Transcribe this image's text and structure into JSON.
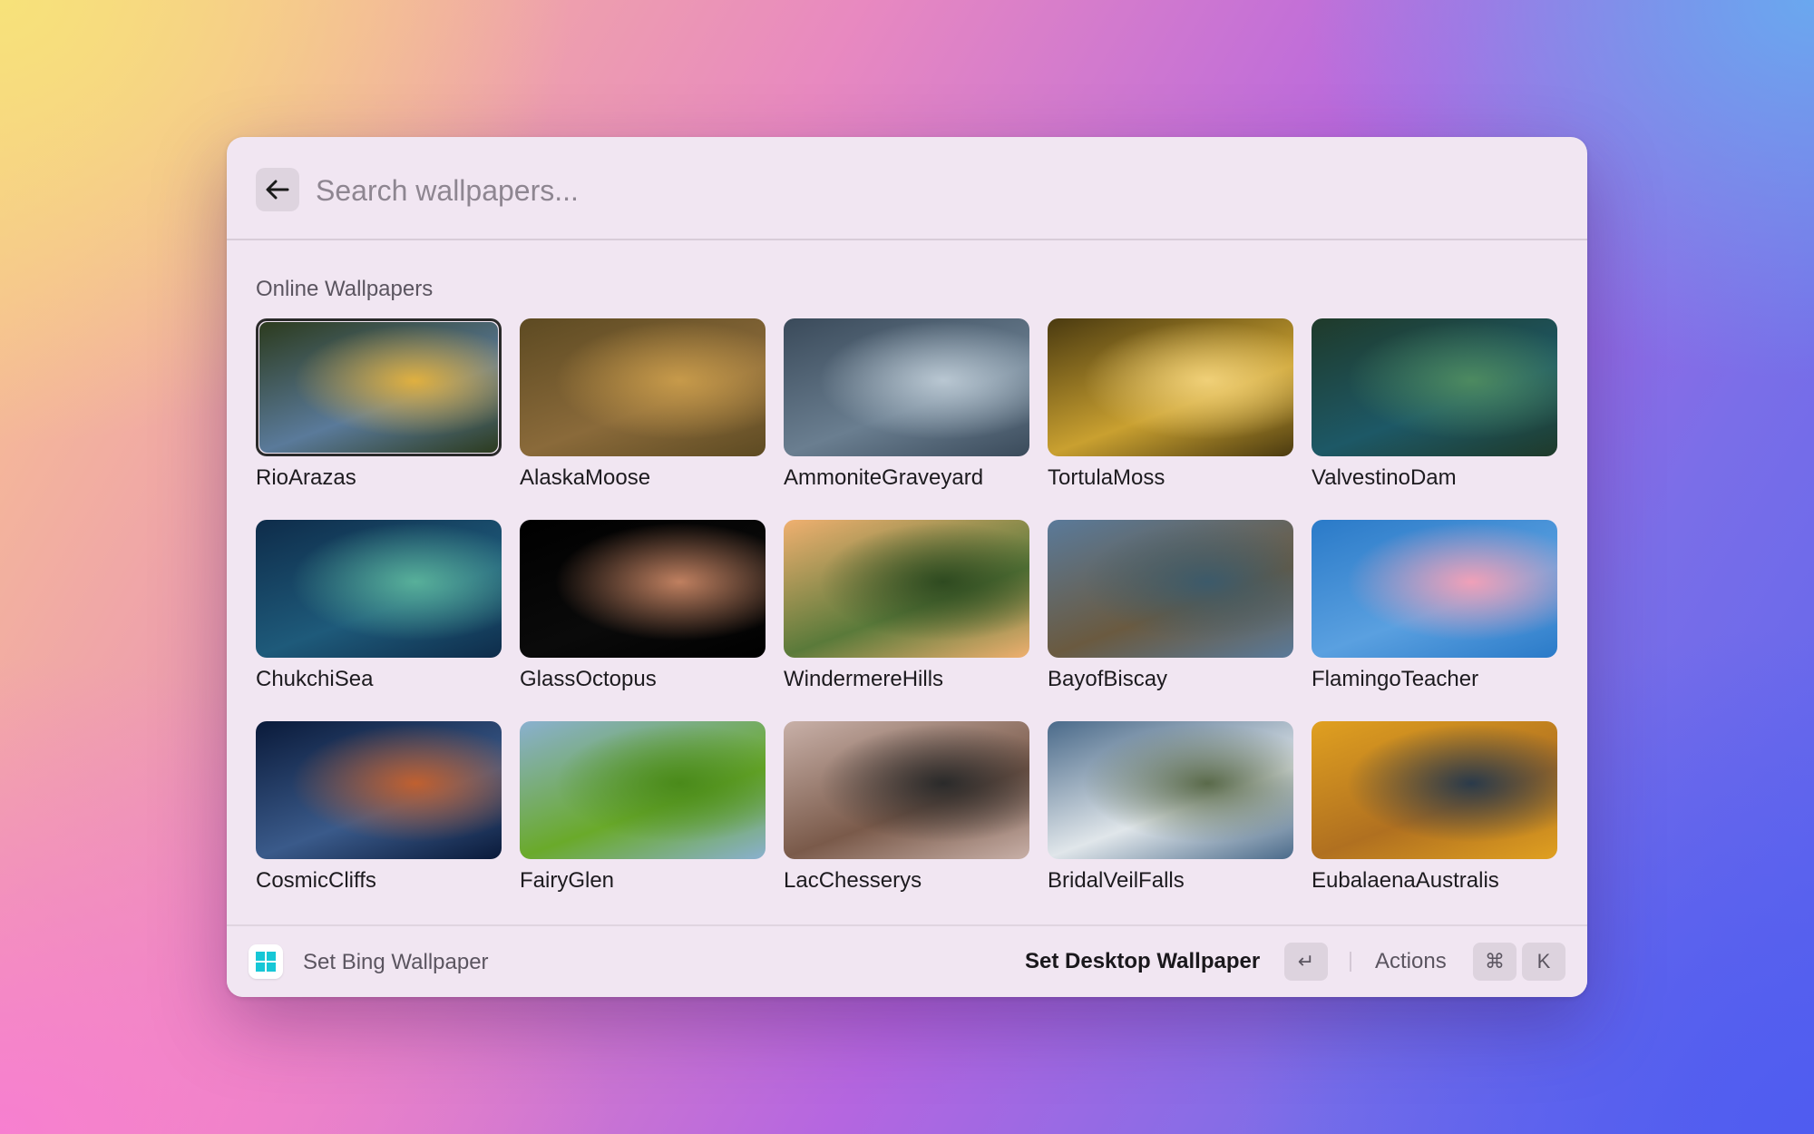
{
  "search": {
    "placeholder": "Search wallpapers..."
  },
  "section": {
    "title": "Online Wallpapers"
  },
  "wallpapers": [
    {
      "name": "RioArazas",
      "selected": true,
      "colors": [
        "#2c3b1e",
        "#5a7a9a",
        "#e0b040"
      ]
    },
    {
      "name": "AlaskaMoose",
      "colors": [
        "#5d4a22",
        "#8a6a3a",
        "#c79a4a"
      ]
    },
    {
      "name": "AmmoniteGraveyard",
      "colors": [
        "#3a4a5a",
        "#6a7e90",
        "#b9c7d2"
      ]
    },
    {
      "name": "TortulaMoss",
      "colors": [
        "#4a3a10",
        "#c9a030",
        "#f0d078"
      ]
    },
    {
      "name": "ValvestinoDam",
      "colors": [
        "#1f3a2a",
        "#1d5866",
        "#4d8a60"
      ]
    },
    {
      "name": "ChukchiSea",
      "colors": [
        "#0e2c4a",
        "#1e5a7a",
        "#58b09a"
      ]
    },
    {
      "name": "GlassOctopus",
      "colors": [
        "#000000",
        "#0a0a0a",
        "#c08060"
      ]
    },
    {
      "name": "WindermereHills",
      "colors": [
        "#f0b070",
        "#5a7a3a",
        "#2e4a20"
      ]
    },
    {
      "name": "BayofBiscay",
      "colors": [
        "#5a7a9a",
        "#6a5a40",
        "#3c5a6a"
      ]
    },
    {
      "name": "FlamingoTeacher",
      "colors": [
        "#2a7ac8",
        "#5aa0e0",
        "#f0a0b8"
      ]
    },
    {
      "name": "CosmicCliffs",
      "colors": [
        "#0a1a3a",
        "#3a5a8a",
        "#c06030"
      ]
    },
    {
      "name": "FairyGlen",
      "colors": [
        "#8ab0d0",
        "#6aaa2a",
        "#4a8a1a"
      ]
    },
    {
      "name": "LacChesserys",
      "colors": [
        "#c8b0a8",
        "#7a5a4a",
        "#2a2a2a"
      ]
    },
    {
      "name": "BridalVeilFalls",
      "colors": [
        "#4a6a8a",
        "#e0e6ea",
        "#5a6a4a"
      ]
    },
    {
      "name": "EubalaenaAustralis",
      "colors": [
        "#e0a020",
        "#b07020",
        "#2a3a4a"
      ]
    }
  ],
  "footer": {
    "title": "Set Bing Wallpaper",
    "primary_action": "Set Desktop Wallpaper",
    "enter_key": "↵",
    "actions_label": "Actions",
    "cmd_key": "⌘",
    "k_key": "K"
  },
  "icons": {
    "back": "arrow-left-icon",
    "app": "windows-logo-icon"
  },
  "accent": {
    "app_icon_color": "#17c7d6"
  }
}
